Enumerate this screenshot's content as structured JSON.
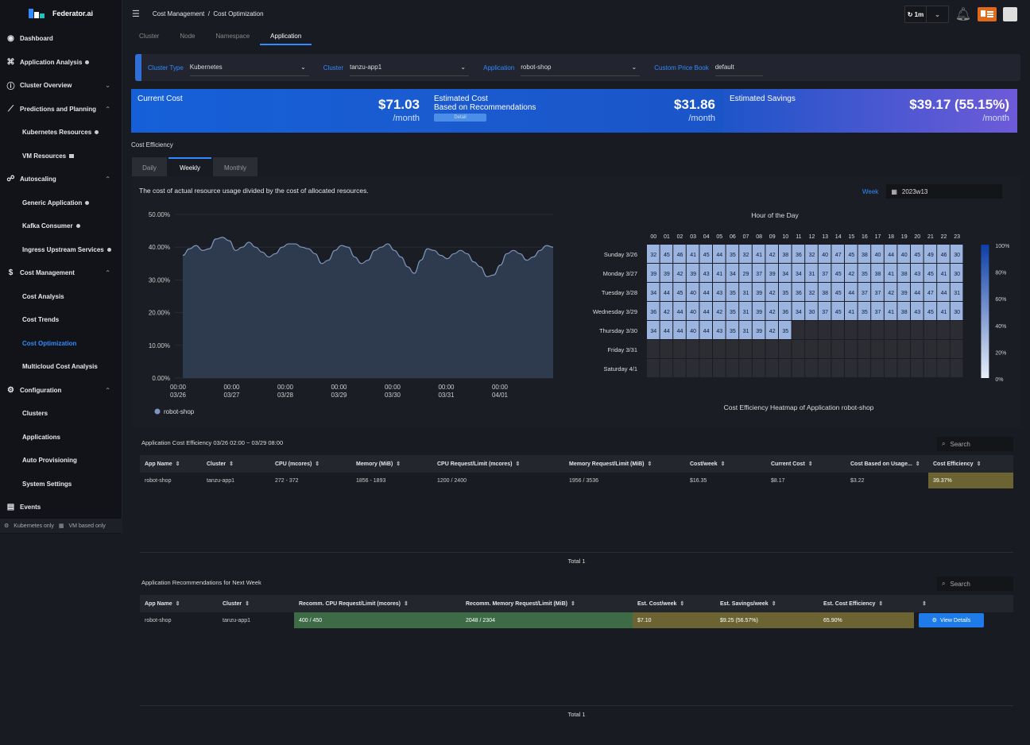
{
  "brand": {
    "name": "Federator.ai"
  },
  "sidebar": {
    "items": [
      {
        "label": "Dashboard",
        "level": "top",
        "icon": "dashboard-icon"
      },
      {
        "label": "Application Analysis",
        "level": "top",
        "icon": "network-icon"
      },
      {
        "label": "Cluster Overview",
        "level": "top",
        "icon": "info-icon"
      },
      {
        "label": "Predictions and Planning",
        "level": "top",
        "icon": "chart-icon"
      },
      {
        "label": "Kubernetes Resources",
        "level": "sub"
      },
      {
        "label": "VM Resources",
        "level": "sub"
      },
      {
        "label": "Autoscaling",
        "level": "top",
        "icon": "autoscaling-icon"
      },
      {
        "label": "Generic Application",
        "level": "sub"
      },
      {
        "label": "Kafka Consumer",
        "level": "sub"
      },
      {
        "label": "Ingress Upstream Services",
        "level": "sub"
      },
      {
        "label": "Cost Management",
        "level": "top",
        "icon": "dollar-icon"
      },
      {
        "label": "Cost Analysis",
        "level": "sub"
      },
      {
        "label": "Cost Trends",
        "level": "sub"
      },
      {
        "label": "Cost Optimization",
        "level": "sub",
        "active": true
      },
      {
        "label": "Multicloud Cost Analysis",
        "level": "sub"
      },
      {
        "label": "Configuration",
        "level": "top",
        "icon": "gear-icon"
      },
      {
        "label": "Clusters",
        "level": "sub"
      },
      {
        "label": "Applications",
        "level": "sub"
      },
      {
        "label": "Auto Provisioning",
        "level": "sub"
      },
      {
        "label": "System Settings",
        "level": "sub"
      },
      {
        "label": "Events",
        "level": "top",
        "icon": "calendar-icon"
      }
    ],
    "footer": {
      "k8s": "Kubernetes only",
      "vm": "VM based only"
    }
  },
  "header": {
    "crumb1": "Cost Management",
    "crumb_sep": "/",
    "crumb2": "Cost Optimization",
    "refresh": "1m"
  },
  "tabs": [
    "Cluster",
    "Node",
    "Namespace",
    "Application"
  ],
  "active_tab": "Application",
  "filters": {
    "cluster_type_label": "Cluster Type",
    "cluster_type": "Kubernetes",
    "cluster_label": "Cluster",
    "cluster": "tanzu-app1",
    "application_label": "Application",
    "application": "robot-shop",
    "price_book_label": "Custom Price Book",
    "price_book": "default"
  },
  "costs": {
    "current_label": "Current Cost",
    "current": "$71.03",
    "current_unit": "/month",
    "estimated_label1": "Estimated Cost",
    "estimated_label2": "Based on Recommendations",
    "detail": "Detail",
    "estimated": "$31.86",
    "estimated_unit": "/month",
    "savings_label": "Estimated Savings",
    "savings": "$39.17 (55.15%)",
    "savings_unit": "/month"
  },
  "efficiency": {
    "section": "Cost Efficiency",
    "tabs": [
      "Daily",
      "Weekly",
      "Monthly"
    ],
    "active": "Weekly",
    "desc": "The cost of actual resource usage divided by the cost of allocated resources.",
    "week_label": "Week",
    "week": "2023w13",
    "heat_title": "Hour of the Day",
    "heat_caption": "Cost Efficiency Heatmap of Application robot-shop"
  },
  "chart_data": [
    {
      "type": "area",
      "title": "",
      "yticks": [
        "50.00%",
        "40.00%",
        "30.00%",
        "20.00%",
        "10.00%",
        "0.00%"
      ],
      "ylim": [
        0,
        50
      ],
      "xticks": [
        [
          "00:00",
          "03/26"
        ],
        [
          "00:00",
          "03/27"
        ],
        [
          "00:00",
          "03/28"
        ],
        [
          "00:00",
          "03/29"
        ],
        [
          "00:00",
          "03/30"
        ],
        [
          "00:00",
          "03/31"
        ],
        [
          "00:00",
          "04/01"
        ]
      ],
      "series": [
        {
          "name": "robot-shop",
          "values": [
            37.5,
            39.5,
            40.5,
            39,
            39.5,
            42.5,
            43,
            42,
            39,
            40,
            41.5,
            40,
            38.5,
            37,
            38,
            40,
            41,
            41,
            40,
            39.5,
            38,
            35,
            36,
            39,
            40.5,
            40,
            37,
            35,
            36,
            39,
            40,
            41,
            39,
            37,
            34,
            32,
            36,
            39.5,
            39,
            37.5,
            36.5,
            38,
            39,
            38,
            35.5,
            34,
            31,
            31.5,
            34.5,
            38,
            39,
            38,
            36,
            37,
            39,
            40.5,
            40
          ]
        }
      ]
    },
    {
      "type": "heatmap",
      "hours": [
        "00",
        "01",
        "02",
        "03",
        "04",
        "05",
        "06",
        "07",
        "08",
        "09",
        "10",
        "11",
        "12",
        "13",
        "14",
        "15",
        "16",
        "17",
        "18",
        "19",
        "20",
        "21",
        "22",
        "23"
      ],
      "days": [
        "Sunday 3/26",
        "Monday 3/27",
        "Tuesday 3/28",
        "Wednesday 3/29",
        "Thursday 3/30",
        "Friday 3/31",
        "Saturday 4/1"
      ],
      "values": [
        [
          32,
          45,
          46,
          41,
          45,
          44,
          35,
          32,
          41,
          42,
          38,
          36,
          32,
          40,
          47,
          45,
          38,
          40,
          44,
          40,
          45,
          49,
          46,
          30
        ],
        [
          39,
          39,
          42,
          39,
          43,
          41,
          34,
          29,
          37,
          39,
          34,
          34,
          31,
          37,
          45,
          42,
          35,
          38,
          41,
          38,
          43,
          45,
          41,
          30
        ],
        [
          34,
          44,
          45,
          40,
          44,
          43,
          35,
          31,
          39,
          42,
          35,
          36,
          32,
          38,
          45,
          44,
          37,
          37,
          42,
          39,
          44,
          47,
          44,
          31
        ],
        [
          36,
          42,
          44,
          40,
          44,
          42,
          35,
          31,
          39,
          42,
          36,
          34,
          30,
          37,
          45,
          41,
          35,
          37,
          41,
          38,
          43,
          45,
          41,
          30
        ],
        [
          34,
          44,
          44,
          40,
          44,
          43,
          35,
          31,
          39,
          42,
          35,
          null,
          null,
          null,
          null,
          null,
          null,
          null,
          null,
          null,
          null,
          null,
          null,
          null
        ],
        [
          null,
          null,
          null,
          null,
          null,
          null,
          null,
          null,
          null,
          null,
          null,
          null,
          null,
          null,
          null,
          null,
          null,
          null,
          null,
          null,
          null,
          null,
          null,
          null
        ],
        [
          null,
          null,
          null,
          null,
          null,
          null,
          null,
          null,
          null,
          null,
          null,
          null,
          null,
          null,
          null,
          null,
          null,
          null,
          null,
          null,
          null,
          null,
          null,
          null
        ]
      ],
      "scale": [
        "100%",
        "80%",
        "60%",
        "40%",
        "20%",
        "0%"
      ]
    }
  ],
  "app_table": {
    "title": "Application Cost Efficiency 03/26 02:00 ~ 03/29 08:00",
    "search": "Search",
    "columns": [
      "App Name",
      "Cluster",
      "CPU (mcores)",
      "Memory (MiB)",
      "CPU Request/Limit (mcores)",
      "Memory Request/Limit (MiB)",
      "Cost/week",
      "Current Cost",
      "Cost Based on Usage...",
      "Cost Efficiency"
    ],
    "rows": [
      [
        "robot-shop",
        "tanzu-app1",
        "272 - 372",
        "1856 - 1893",
        "1200 / 2400",
        "1956 / 3536",
        "$16.35",
        "$8.17",
        "$3.22",
        "39.37%"
      ]
    ],
    "total": "Total 1"
  },
  "rec_table": {
    "title": "Application Recommendations for Next Week",
    "search": "Search",
    "columns": [
      "App Name",
      "Cluster",
      "Recomm. CPU Request/Limit (mcores)",
      "Recomm. Memory Request/Limit (MiB)",
      "Est. Cost/week",
      "Est. Savings/week",
      "Est. Cost Efficiency",
      ""
    ],
    "rows": [
      [
        "robot-shop",
        "tanzu-app1",
        "400 / 450",
        "2048 / 2304",
        "$7.10",
        "$9.25 (56.57%)",
        "65.90%"
      ]
    ],
    "view": "View Details",
    "total": "Total 1"
  },
  "colors": {
    "accent": "#2f8bff",
    "green": "#3d6b45",
    "olive": "#6b6432",
    "heat_on": "#9cb4e0",
    "heat_off": "#2c2d33"
  }
}
